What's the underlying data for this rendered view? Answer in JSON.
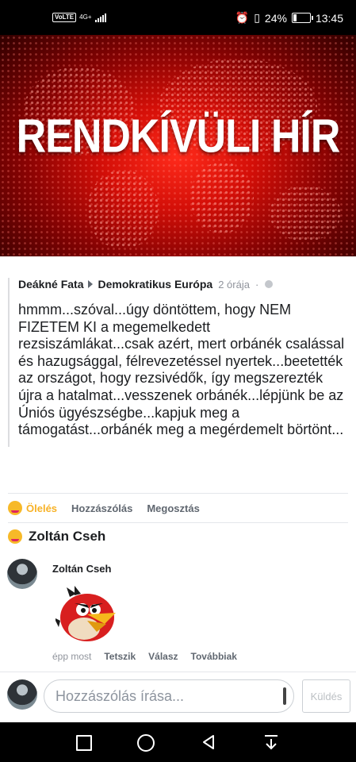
{
  "status_bar": {
    "volte": "VoLTE",
    "network": "4G+",
    "battery": "24%",
    "battery_level": 0.24,
    "time": "13:45",
    "icons": [
      "alarm-icon",
      "vibrate-icon",
      "battery-icon",
      "signal-icon"
    ]
  },
  "banner": {
    "title": "RENDKÍVÜLI HÍR"
  },
  "post": {
    "author": "Deákné Fata",
    "group": "Demokratikus Európa",
    "time": "2 órája",
    "text": "hmmm...szóval...úgy döntöttem, hogy NEM FIZETEM KI a megemelkedett rezsiszámlákat...csak azért, mert orbánék csalással és hazugsággal, félrevezetéssel nyertek...beetették az országot, hogy rezsivédők, így megszerezték újra a hatalmat...vesszenek orbánék...lépjünk be az Úniós ügyészségbe...kapjuk meg a támogatást...orbánék meg a megérdemelt börtönt..."
  },
  "actions": {
    "hug": "Ölelés",
    "comment": "Hozzászólás",
    "share": "Megosztás",
    "hug_color": "#f7b125"
  },
  "reactor": {
    "name": "Zoltán Cseh"
  },
  "comment": {
    "author": "Zoltán Cseh",
    "time": "épp most",
    "like": "Tetszik",
    "reply": "Válasz",
    "more": "Továbbiak"
  },
  "composer": {
    "placeholder": "Hozzászólás írása...",
    "send": "Küldés"
  }
}
